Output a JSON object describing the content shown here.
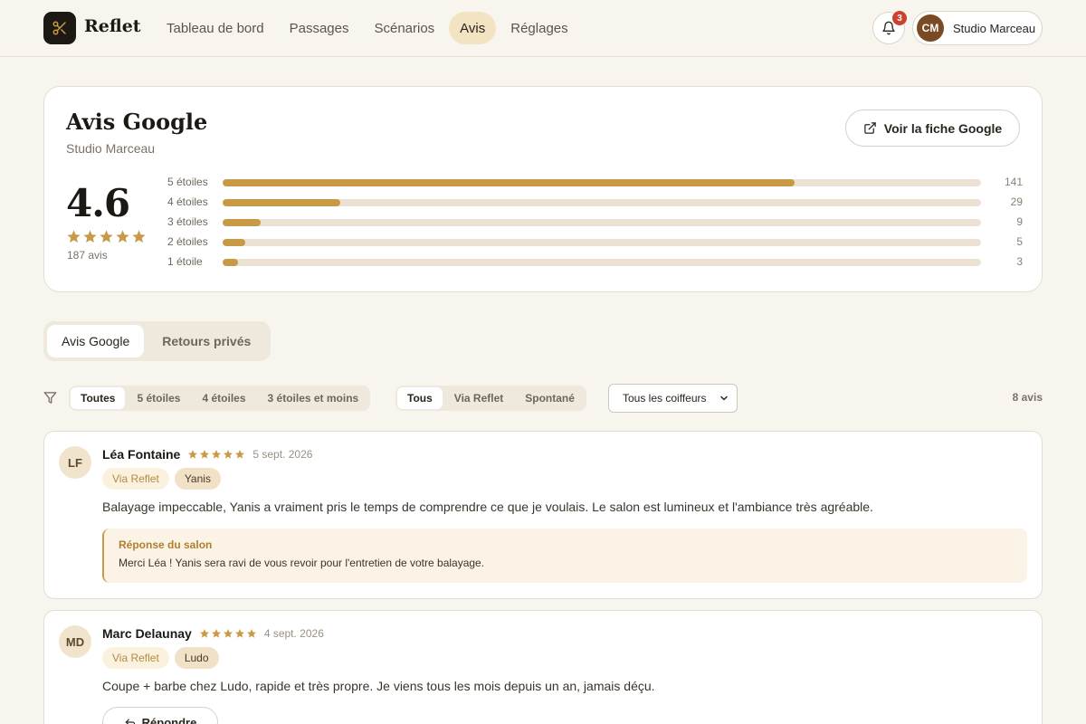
{
  "brand": {
    "name": "Reflet"
  },
  "nav": {
    "items": [
      {
        "label": "Tableau de bord"
      },
      {
        "label": "Passages"
      },
      {
        "label": "Scénarios"
      },
      {
        "label": "Avis"
      },
      {
        "label": "Réglages"
      }
    ],
    "active": "Avis"
  },
  "notifications": {
    "count": "3"
  },
  "account": {
    "initials": "CM",
    "name": "Studio Marceau"
  },
  "summary": {
    "title": "Avis Google",
    "subtitle": "Studio Marceau",
    "google_button": "Voir la fiche Google",
    "rating": "4.6",
    "stars": 5,
    "review_count": "187 avis",
    "distribution": [
      {
        "label": "5 étoiles",
        "count": "141",
        "fraction": 0.754
      },
      {
        "label": "4 étoiles",
        "count": "29",
        "fraction": 0.155
      },
      {
        "label": "3 étoiles",
        "count": "9",
        "fraction": 0.05
      },
      {
        "label": "2 étoiles",
        "count": "5",
        "fraction": 0.03
      },
      {
        "label": "1 étoile",
        "count": "3",
        "fraction": 0.02
      }
    ]
  },
  "tabs": [
    {
      "label": "Avis Google"
    },
    {
      "label": "Retours privés"
    }
  ],
  "filters": {
    "rating": [
      "Toutes",
      "5 étoiles",
      "4 étoiles",
      "3 étoiles et moins"
    ],
    "source": [
      "Tous",
      "Via Reflet",
      "Spontané"
    ],
    "stylist_select": "Tous les coiffeurs",
    "result_count": "8 avis"
  },
  "reviews": [
    {
      "initials": "LF",
      "name": "Léa Fontaine",
      "rating": 5,
      "date": "5 sept. 2026",
      "source": "Via Reflet",
      "stylist": "Yanis",
      "text": "Balayage impeccable, Yanis a vraiment pris le temps de comprendre ce que je voulais. Le salon est lumineux et l'ambiance très agréable.",
      "response_title": "Réponse du salon",
      "response_text": "Merci Léa ! Yanis sera ravi de vous revoir pour l'entretien de votre balayage."
    },
    {
      "initials": "MD",
      "name": "Marc Delaunay",
      "rating": 5,
      "date": "4 sept. 2026",
      "source": "Via Reflet",
      "stylist": "Ludo",
      "text": "Coupe + barbe chez Ludo, rapide et très propre. Je viens tous les mois depuis un an, jamais déçu.",
      "reply_button": "Répondre"
    }
  ],
  "colors": {
    "accent": "#c89a45",
    "background": "#f8f5ef",
    "dark": "#1c1813",
    "badge": "#c9432f"
  }
}
